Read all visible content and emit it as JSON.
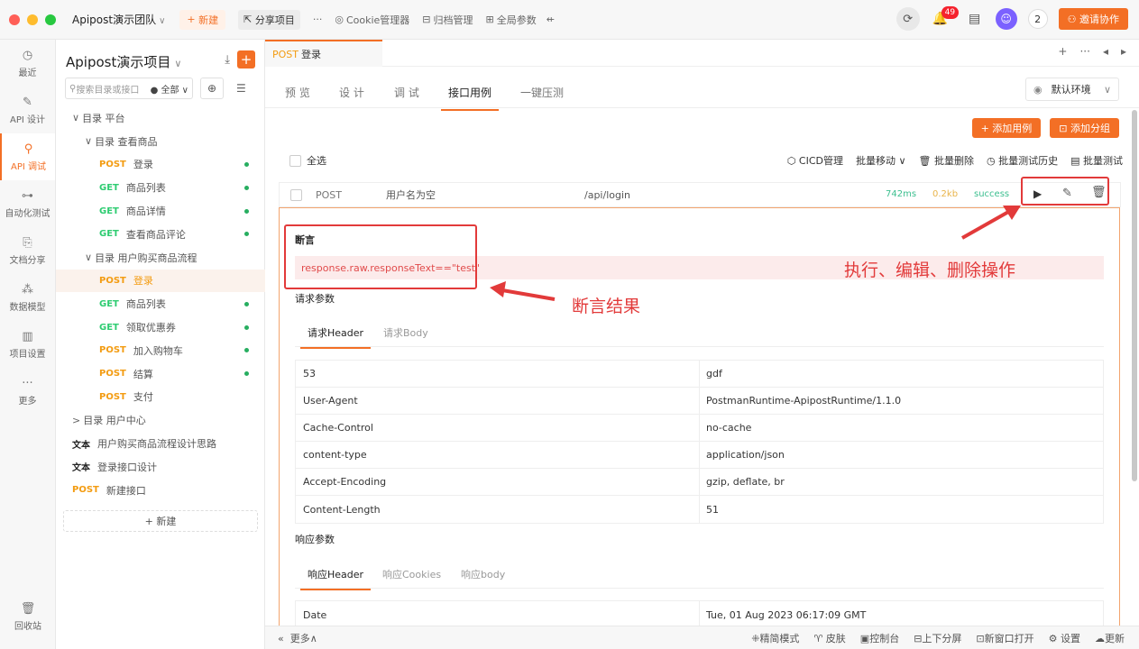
{
  "topbar": {
    "team": "Apipost演示团队",
    "new_label": "新建",
    "share_label": "分享项目",
    "more": "···",
    "cookie_label": "Cookie管理器",
    "archive_label": "归档管理",
    "global_label": "全局参数",
    "notif_count": "49",
    "member_count": "2",
    "invite_label": "邀请协作",
    "colors": {
      "accent": "#f36f25",
      "red": "#ff5f57",
      "yellow": "#febc2e",
      "green": "#28c840"
    }
  },
  "leftnav": {
    "items": [
      {
        "label": "最近",
        "icon": "clock-icon"
      },
      {
        "label": "API 设计",
        "icon": "edit-icon"
      },
      {
        "label": "API 调试",
        "icon": "debug-icon"
      },
      {
        "label": "自动化测试",
        "icon": "flow-icon"
      },
      {
        "label": "文档分享",
        "icon": "doc-icon"
      },
      {
        "label": "数据模型",
        "icon": "model-icon"
      },
      {
        "label": "项目设置",
        "icon": "settings-icon"
      },
      {
        "label": "更多",
        "icon": "more-icon"
      }
    ],
    "trash": "回收站"
  },
  "tree": {
    "project": "Apipost演示项目",
    "search_placeholder": "搜索目录或接口",
    "filter": "全部",
    "rows": [
      {
        "m": "",
        "label": "目录  平台",
        "lvl": 0,
        "dir": "down"
      },
      {
        "m": "",
        "label": "目录  查看商品",
        "lvl": 1,
        "dir": "down"
      },
      {
        "m": "POST",
        "label": "登录",
        "lvl": 2,
        "dot": true
      },
      {
        "m": "GET",
        "label": "商品列表",
        "lvl": 2,
        "dot": true
      },
      {
        "m": "GET",
        "label": "商品详情",
        "lvl": 2,
        "dot": true
      },
      {
        "m": "GET",
        "label": "查看商品评论",
        "lvl": 2,
        "dot": true
      },
      {
        "m": "",
        "label": "目录  用户购买商品流程",
        "lvl": 1,
        "dir": "down"
      },
      {
        "m": "POST",
        "label": "登录",
        "lvl": 2,
        "active": true
      },
      {
        "m": "GET",
        "label": "商品列表",
        "lvl": 2,
        "dot": true
      },
      {
        "m": "GET",
        "label": "领取优惠券",
        "lvl": 2,
        "dot": true
      },
      {
        "m": "POST",
        "label": "加入购物车",
        "lvl": 2,
        "dot": true
      },
      {
        "m": "POST",
        "label": "结算",
        "lvl": 2,
        "dot": true
      },
      {
        "m": "POST",
        "label": "支付",
        "lvl": 2
      },
      {
        "m": "",
        "label": "目录  用户中心",
        "lvl": 0,
        "dir": "right"
      },
      {
        "m": "文本",
        "label": "用户购买商品流程设计思路",
        "lvl": 0
      },
      {
        "m": "文本",
        "label": "登录接口设计",
        "lvl": 0
      },
      {
        "m": "POST",
        "label": "新建接口",
        "lvl": 0
      }
    ],
    "new_label": "新建"
  },
  "main": {
    "tab_method": "POST",
    "tab_title": "登录",
    "subtabs": [
      "预 览",
      "设 计",
      "调 试",
      "接口用例",
      "一键压测"
    ],
    "env": "默认环境",
    "add_case": "添加用例",
    "add_group": "添加分组",
    "select_all": "全选",
    "cicd": "CICD管理",
    "batch_move": "批量移动",
    "batch_delete": "批量删除",
    "batch_history": "批量测试历史",
    "batch_test": "批量测试",
    "case": {
      "method": "POST",
      "name": "用户名为空",
      "path": "/api/login",
      "time": "742ms",
      "size": "0.2kb",
      "status": "success"
    },
    "assert_title": "断言",
    "assert_expr": "response.raw.responseText==\"test\"",
    "req_params": "请求参数",
    "req_tabs": [
      "请求Header",
      "请求Body"
    ],
    "req_headers": [
      {
        "k": "53",
        "v": "gdf"
      },
      {
        "k": "User-Agent",
        "v": "PostmanRuntime-ApipostRuntime/1.1.0"
      },
      {
        "k": "Cache-Control",
        "v": "no-cache"
      },
      {
        "k": "content-type",
        "v": "application/json"
      },
      {
        "k": "Accept-Encoding",
        "v": "gzip, deflate, br"
      },
      {
        "k": "Content-Length",
        "v": "51"
      }
    ],
    "resp_params": "响应参数",
    "resp_tabs": [
      "响应Header",
      "响应Cookies",
      "响应body"
    ],
    "resp_headers": [
      {
        "k": "Date",
        "v": "Tue, 01 Aug 2023 06:17:09 GMT"
      }
    ],
    "annot_actions": "执行、编辑、删除操作",
    "annot_assert": "断言结果"
  },
  "statusbar": {
    "more": "更多",
    "items": [
      "精简模式",
      "皮肤",
      "控制台",
      "上下分屏",
      "新窗口打开",
      "设置",
      "更新"
    ]
  }
}
